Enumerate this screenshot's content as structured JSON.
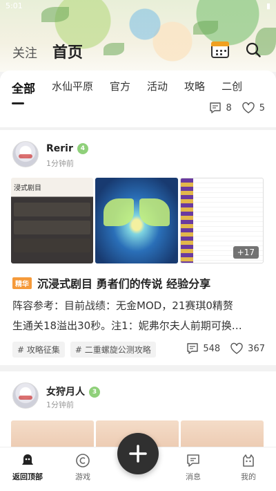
{
  "status_bar": {
    "time": "5:01"
  },
  "header": {
    "follow_label": "关注",
    "home_label": "首页"
  },
  "tabs": [
    {
      "label": "全部",
      "active": true
    },
    {
      "label": "水仙平原"
    },
    {
      "label": "官方"
    },
    {
      "label": "活动"
    },
    {
      "label": "攻略"
    },
    {
      "label": "二创"
    }
  ],
  "previous_post": {
    "comments": "8",
    "likes": "5"
  },
  "post1": {
    "username": "Rerir",
    "level": "4",
    "time": "1分钟前",
    "image_overlay_title": "浸式剧目",
    "more_images": "+17",
    "essence_badge": "精华",
    "title": "沉浸式剧目 勇者们的传说 经验分享",
    "excerpt_line1": "阵容参考：目前战绩：无金MOD，21赛琪0精赘",
    "excerpt_line2": "生通关18溢出30秒。注1：妮弗尔夫人前期可换…",
    "tags": [
      "攻略征集",
      "二重螺旋公测攻略"
    ],
    "comments": "548",
    "likes": "367"
  },
  "post2": {
    "username": "女狩月人",
    "level": "3",
    "time": "1分钟前"
  },
  "tabbar": {
    "back_top": "返回顶部",
    "games": "游戏",
    "messages": "消息",
    "mine": "我的"
  },
  "colors": {
    "essence": "#f59a3a",
    "level_badge": "#8fd07a",
    "fab": "#303030"
  }
}
